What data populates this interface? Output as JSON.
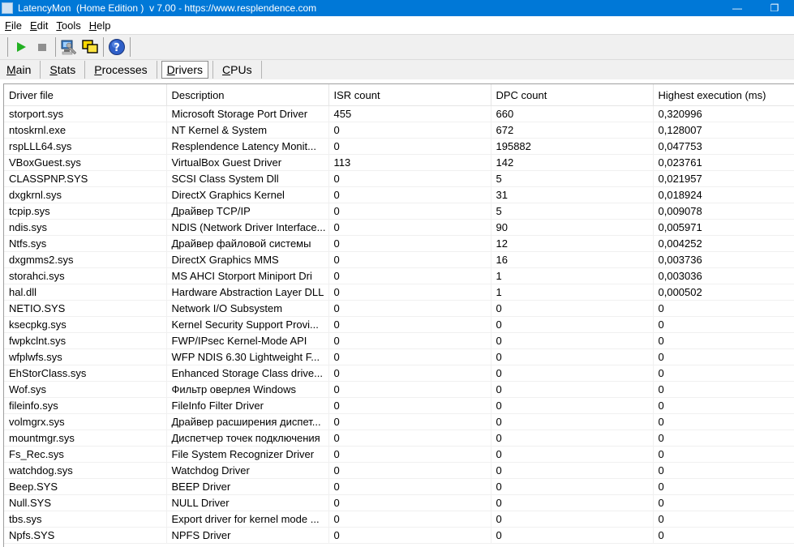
{
  "window": {
    "title": "LatencyMon  (Home Edition )  v 7.00 - https://www.resplendence.com",
    "minimize_glyph": "—",
    "restore_glyph": "❐"
  },
  "menu": [
    {
      "accel": "F",
      "rest": "ile"
    },
    {
      "accel": "E",
      "rest": "dit"
    },
    {
      "accel": "T",
      "rest": "ools"
    },
    {
      "accel": "H",
      "rest": "elp"
    }
  ],
  "toolbar": {
    "icons": [
      "play-icon",
      "stop-icon",
      "computer-wrench-icon",
      "windows-icon",
      "help-icon"
    ],
    "help_glyph": "?"
  },
  "tabs": [
    {
      "accel": "M",
      "rest": "ain",
      "active": false
    },
    {
      "accel": "S",
      "rest": "tats",
      "active": false
    },
    {
      "accel": "P",
      "rest": "rocesses",
      "active": false
    },
    {
      "accel": "D",
      "rest": "rivers",
      "active": true
    },
    {
      "accel": "C",
      "rest": "PUs",
      "active": false
    }
  ],
  "table": {
    "columns": [
      "Driver file",
      "Description",
      "ISR count",
      "DPC count",
      "Highest execution (ms)"
    ],
    "rows": [
      [
        "storport.sys",
        "Microsoft Storage Port Driver",
        "455",
        "660",
        "0,320996"
      ],
      [
        "ntoskrnl.exe",
        "NT Kernel & System",
        "0",
        "672",
        "0,128007"
      ],
      [
        "rspLLL64.sys",
        "Resplendence Latency Monit...",
        "0",
        "195882",
        "0,047753"
      ],
      [
        "VBoxGuest.sys",
        "VirtualBox Guest Driver",
        "113",
        "142",
        "0,023761"
      ],
      [
        "CLASSPNP.SYS",
        "SCSI Class System Dll",
        "0",
        "5",
        "0,021957"
      ],
      [
        "dxgkrnl.sys",
        "DirectX Graphics Kernel",
        "0",
        "31",
        "0,018924"
      ],
      [
        "tcpip.sys",
        "Драйвер TCP/IP",
        "0",
        "5",
        "0,009078"
      ],
      [
        "ndis.sys",
        "NDIS (Network Driver Interface...",
        "0",
        "90",
        "0,005971"
      ],
      [
        "Ntfs.sys",
        "Драйвер файловой системы",
        "0",
        "12",
        "0,004252"
      ],
      [
        "dxgmms2.sys",
        "DirectX Graphics MMS",
        "0",
        "16",
        "0,003736"
      ],
      [
        "storahci.sys",
        "MS AHCI Storport Miniport Dri",
        "0",
        "1",
        "0,003036"
      ],
      [
        "hal.dll",
        "Hardware Abstraction Layer DLL",
        "0",
        "1",
        "0,000502"
      ],
      [
        "NETIO.SYS",
        "Network I/O Subsystem",
        "0",
        "0",
        "0"
      ],
      [
        "ksecpkg.sys",
        "Kernel Security Support Provi...",
        "0",
        "0",
        "0"
      ],
      [
        "fwpkclnt.sys",
        "FWP/IPsec Kernel-Mode API",
        "0",
        "0",
        "0"
      ],
      [
        "wfplwfs.sys",
        "WFP NDIS 6.30 Lightweight F...",
        "0",
        "0",
        "0"
      ],
      [
        "EhStorClass.sys",
        "Enhanced Storage Class drive...",
        "0",
        "0",
        "0"
      ],
      [
        "Wof.sys",
        "Фильтр оверлея Windows",
        "0",
        "0",
        "0"
      ],
      [
        "fileinfo.sys",
        "FileInfo Filter Driver",
        "0",
        "0",
        "0"
      ],
      [
        "volmgrx.sys",
        "Драйвер расширения диспет...",
        "0",
        "0",
        "0"
      ],
      [
        "mountmgr.sys",
        "Диспетчер точек подключения",
        "0",
        "0",
        "0"
      ],
      [
        "Fs_Rec.sys",
        "File System Recognizer Driver",
        "0",
        "0",
        "0"
      ],
      [
        "watchdog.sys",
        "Watchdog Driver",
        "0",
        "0",
        "0"
      ],
      [
        "Beep.SYS",
        "BEEP Driver",
        "0",
        "0",
        "0"
      ],
      [
        "Null.SYS",
        "NULL Driver",
        "0",
        "0",
        "0"
      ],
      [
        "tbs.sys",
        "Export driver for kernel mode ...",
        "0",
        "0",
        "0"
      ],
      [
        "Npfs.SYS",
        "NPFS Driver",
        "0",
        "0",
        "0"
      ]
    ]
  }
}
